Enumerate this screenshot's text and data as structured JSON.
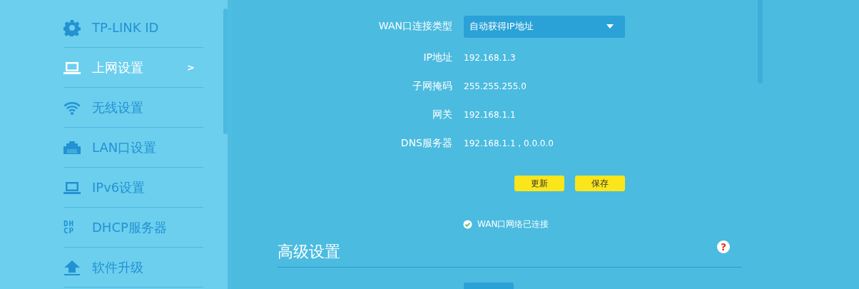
{
  "sidebar": {
    "items": [
      {
        "label": "TP-LINK ID",
        "selected": false
      },
      {
        "label": "上网设置",
        "selected": true,
        "chevron": ">"
      },
      {
        "label": "无线设置",
        "selected": false
      },
      {
        "label": "LAN口设置",
        "selected": false
      },
      {
        "label": "IPv6设置",
        "selected": false
      },
      {
        "label": "DHCP服务器",
        "selected": false,
        "icon_lines": [
          "DH",
          "CP"
        ]
      },
      {
        "label": "软件升级",
        "selected": false
      }
    ]
  },
  "wan": {
    "label": "WAN口连接类型",
    "value": "自动获得IP地址"
  },
  "fields": [
    {
      "label": "IP地址",
      "value": "192.168.1.3"
    },
    {
      "label": "子网掩码",
      "value": "255.255.255.0"
    },
    {
      "label": "网关",
      "value": "192.168.1.1"
    },
    {
      "label": "DNS服务器",
      "value": "192.168.1.1 , 0.0.0.0"
    }
  ],
  "buttons": [
    "更新",
    "保存"
  ],
  "status": {
    "text": "WAN口网络已连接",
    "connected": true
  },
  "advanced": {
    "title": "高级设置",
    "help": "?"
  }
}
